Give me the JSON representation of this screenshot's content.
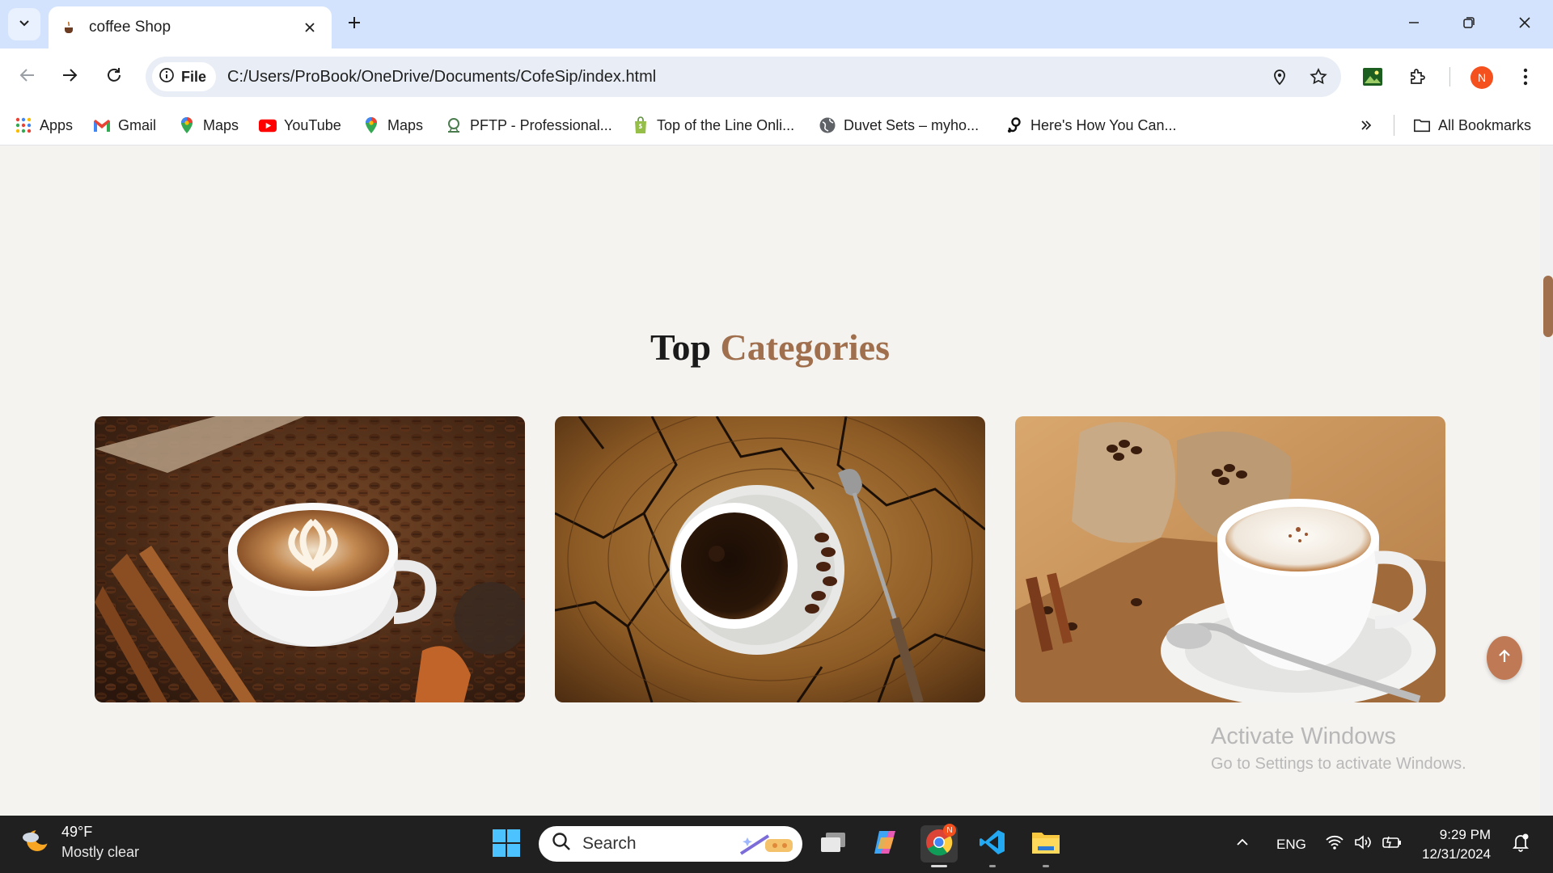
{
  "browser": {
    "tab": {
      "title": "coffee Shop"
    },
    "address": {
      "chip_label": "File",
      "url": "C:/Users/ProBook/OneDrive/Documents/CofeSip/index.html"
    },
    "profile_initial": "N",
    "bookmarks": [
      {
        "label": "Apps",
        "icon": "apps-grid-icon"
      },
      {
        "label": "Gmail",
        "icon": "gmail-icon"
      },
      {
        "label": "Maps",
        "icon": "maps-pin-icon"
      },
      {
        "label": "YouTube",
        "icon": "youtube-icon"
      },
      {
        "label": "Maps",
        "icon": "maps-pin-icon"
      },
      {
        "label": "PFTP - Professional...",
        "icon": "pftp-icon"
      },
      {
        "label": "Top of the Line Onli...",
        "icon": "shopify-bag-icon"
      },
      {
        "label": "Duvet Sets – myho...",
        "icon": "globe-icon"
      },
      {
        "label": "Here's How You Can...",
        "icon": "threads-icon"
      }
    ],
    "all_bookmarks_label": "All Bookmarks"
  },
  "page": {
    "section_title": {
      "main": "Top",
      "accent": "Categories"
    },
    "accent_color": "#a0704e",
    "cards": [
      {
        "image": "latte-art-cup-with-beans-and-cinnamon"
      },
      {
        "image": "black-coffee-on-cracked-wood"
      },
      {
        "image": "cappuccino-with-burlap-bean-sacks"
      }
    ],
    "watermark": {
      "line1": "Activate Windows",
      "line2": "Go to Settings to activate Windows."
    }
  },
  "taskbar": {
    "weather": {
      "temp": "49°F",
      "condition": "Mostly clear"
    },
    "search_placeholder": "Search",
    "language": "ENG",
    "time": "9:29 PM",
    "date": "12/31/2024",
    "chrome_badge": "N"
  }
}
